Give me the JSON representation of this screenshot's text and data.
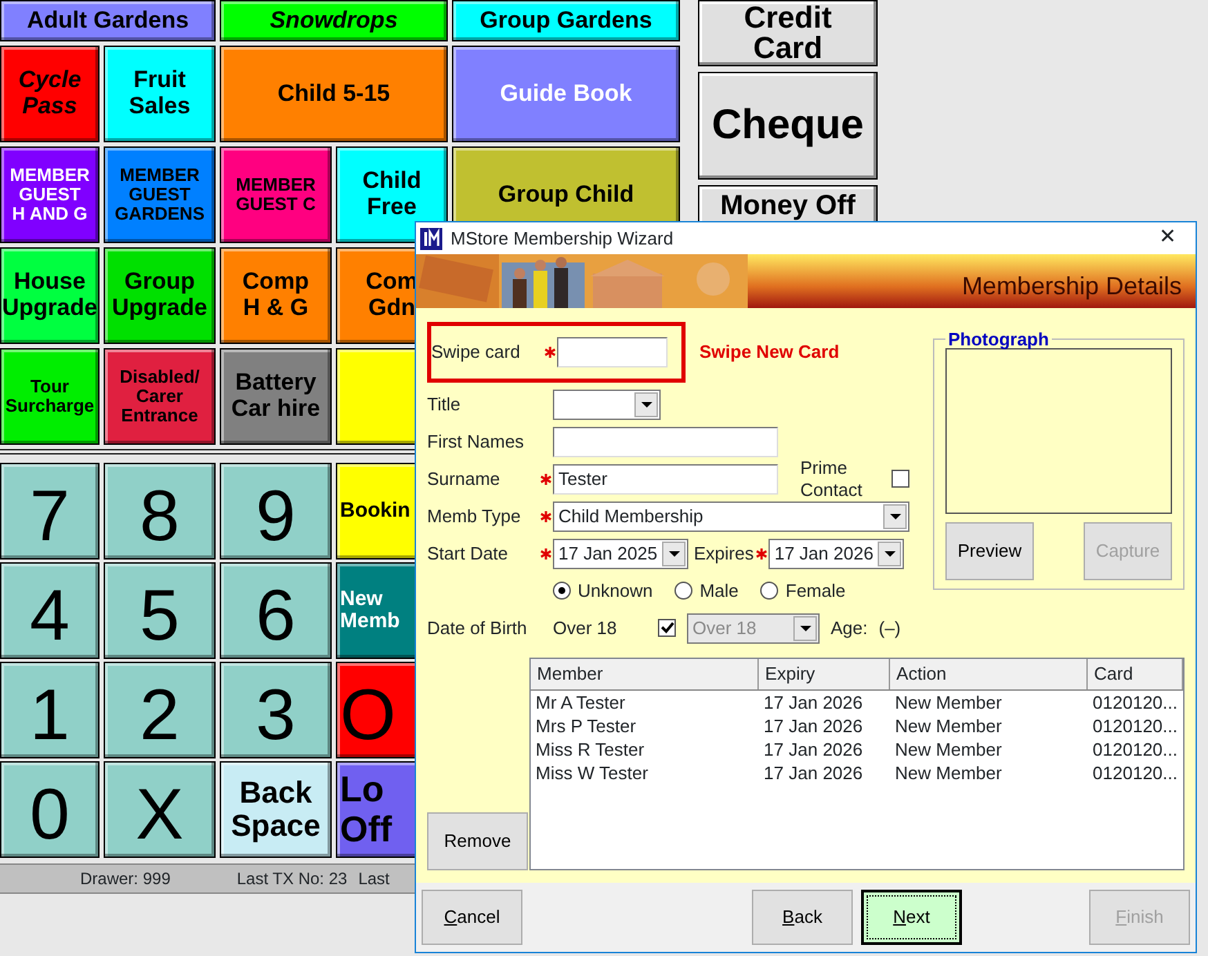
{
  "tile_rows": [
    [
      {
        "lines": [
          "Adult Gardens"
        ],
        "color": "#8080ff",
        "light_text": false,
        "kind": "title",
        "wide": true,
        "italic": false
      },
      {
        "lines": [
          "Snowdrops"
        ],
        "color": "#00ff00",
        "light_text": false,
        "kind": "title",
        "wide": true,
        "italic": true
      },
      {
        "lines": [
          "Group Gardens"
        ],
        "color": "#00ffff",
        "light_text": false,
        "kind": "title",
        "wide": true,
        "italic": false
      }
    ],
    [
      {
        "lines": [
          "Cycle",
          "Pass"
        ],
        "color": "#ff0000",
        "light_text": false,
        "kind": "title",
        "wide": false,
        "italic": true
      },
      {
        "lines": [
          "Fruit",
          "Sales"
        ],
        "color": "#00ffff",
        "light_text": false,
        "kind": "title",
        "wide": false,
        "italic": false
      },
      {
        "lines": [
          "Child 5-15"
        ],
        "color": "#ff8000",
        "light_text": false,
        "kind": "title",
        "wide": true,
        "italic": false
      },
      {
        "lines": [
          "Guide Book"
        ],
        "color": "#8080ff",
        "light_text": true,
        "kind": "title",
        "wide": true,
        "italic": false
      }
    ],
    [
      {
        "lines": [
          "MEMBER",
          "GUEST",
          "H AND G"
        ],
        "color": "#8000ff",
        "light_text": true,
        "kind": "caption",
        "wide": false,
        "italic": false
      },
      {
        "lines": [
          "MEMBER",
          "GUEST",
          "GARDENS"
        ],
        "color": "#0080ff",
        "light_text": false,
        "kind": "caption",
        "wide": false,
        "italic": false
      },
      {
        "lines": [
          "MEMBER",
          "GUEST C"
        ],
        "color": "#ff0080",
        "light_text": false,
        "kind": "caption",
        "wide": false,
        "italic": false
      },
      {
        "lines": [
          "Child",
          "Free"
        ],
        "color": "#00ffff",
        "light_text": false,
        "kind": "title",
        "wide": false,
        "italic": false
      },
      {
        "lines": [
          "Group Child"
        ],
        "color": "#c0c030",
        "light_text": false,
        "kind": "title",
        "wide": true,
        "italic": false
      }
    ],
    [
      {
        "lines": [
          "House",
          "Upgrade"
        ],
        "color": "#00ff40",
        "light_text": false,
        "kind": "title",
        "wide": false,
        "italic": false
      },
      {
        "lines": [
          "Group",
          "Upgrade"
        ],
        "color": "#00e000",
        "light_text": false,
        "kind": "title",
        "wide": false,
        "italic": false
      },
      {
        "lines": [
          "Comp",
          "H & G"
        ],
        "color": "#ff8000",
        "light_text": false,
        "kind": "title",
        "wide": false,
        "italic": false
      },
      {
        "lines": [
          "Com",
          "Gdn"
        ],
        "color": "#ff8000",
        "light_text": false,
        "kind": "title",
        "wide": false,
        "italic": false
      }
    ],
    [
      {
        "lines": [
          "Tour",
          "Surcharge"
        ],
        "color": "#00ee00",
        "light_text": false,
        "kind": "caption",
        "wide": false,
        "italic": false
      },
      {
        "lines": [
          "Disabled/",
          "Carer",
          "Entrance"
        ],
        "color": "#e02040",
        "light_text": false,
        "kind": "caption",
        "wide": false,
        "italic": false
      },
      {
        "lines": [
          "Battery",
          "Car hire"
        ],
        "color": "#808080",
        "light_text": false,
        "kind": "title",
        "wide": false,
        "italic": false
      },
      {
        "color": "#ffff00",
        "kind": "title",
        "wide": false
      }
    ]
  ],
  "keypad_rows": [
    [
      {
        "kind": "digit",
        "lines": [
          "7"
        ],
        "color": "#90d0c8",
        "light_text": false
      },
      {
        "kind": "digit",
        "lines": [
          "8"
        ],
        "color": "#90d0c8",
        "light_text": false
      },
      {
        "kind": "digit",
        "lines": [
          "9"
        ],
        "color": "#90d0c8",
        "light_text": false
      },
      {
        "kind": "word",
        "lines": [
          "Bookin"
        ],
        "color": "#ffff00",
        "light_text": false
      }
    ],
    [
      {
        "kind": "digit",
        "lines": [
          "4"
        ],
        "color": "#90d0c8",
        "light_text": false
      },
      {
        "kind": "digit",
        "lines": [
          "5"
        ],
        "color": "#90d0c8",
        "light_text": false
      },
      {
        "kind": "digit",
        "lines": [
          "6"
        ],
        "color": "#90d0c8",
        "light_text": false
      },
      {
        "kind": "word",
        "lines": [
          "New",
          "Memb"
        ],
        "color": "#008080",
        "light_text": true
      }
    ],
    [
      {
        "kind": "digit",
        "lines": [
          "1"
        ],
        "color": "#90d0c8",
        "light_text": false
      },
      {
        "kind": "digit",
        "lines": [
          "2"
        ],
        "color": "#90d0c8",
        "light_text": false
      },
      {
        "kind": "digit",
        "lines": [
          "3"
        ],
        "color": "#90d0c8",
        "light_text": false
      },
      {
        "kind": "digit",
        "lines": [
          "O"
        ],
        "color": "#ff0000",
        "light_text": false
      }
    ],
    [
      {
        "kind": "digit",
        "lines": [
          "0"
        ],
        "color": "#90d0c8",
        "light_text": false
      },
      {
        "kind": "digit",
        "lines": [
          "X"
        ],
        "color": "#90d0c8",
        "light_text": false
      },
      {
        "kind": "big",
        "lines": [
          "Back",
          "Space"
        ],
        "color": "#c8ecf4",
        "light_text": false
      },
      {
        "kind": "big",
        "lines": [
          "Lo",
          "Off"
        ],
        "color": "#7060f0",
        "light_text": false
      }
    ]
  ],
  "payment_buttons": [
    {
      "lines": [
        "Credit",
        "Card"
      ]
    },
    {
      "lines": [
        "Cheque"
      ]
    },
    {
      "lines": [
        "Money Off"
      ]
    }
  ],
  "status_bar": [
    "Drawer: 999",
    "Last TX No: 23",
    "Last"
  ],
  "dialog": {
    "title": "MStore Membership Wizard",
    "close": "✕",
    "header": "Membership Details",
    "fields": [
      {
        "kind": "text",
        "label": "Swipe card",
        "required": true,
        "highlighted": true,
        "note": "Swipe New Card"
      },
      {
        "kind": "select",
        "label": "Title",
        "required": false,
        "highlighted": false
      },
      {
        "kind": "text",
        "label": "First Names",
        "required": false,
        "highlighted": false
      },
      {
        "kind": "text",
        "label": "Surname",
        "required": true,
        "highlighted": false,
        "value": "Tester",
        "side_checkbox": {
          "label": "Prime Contact",
          "checked": false
        }
      },
      {
        "kind": "select",
        "label": "Memb Type",
        "required": true,
        "highlighted": false,
        "value": "Child Membership"
      },
      {
        "kind": "dates",
        "label": "Start Date",
        "required": true,
        "highlighted": false,
        "value": "17 Jan 2025",
        "expires": {
          "label": "Expires",
          "required": true,
          "value": "17 Jan 2026"
        }
      }
    ],
    "gender": [
      {
        "label": "Unknown",
        "selected": true
      },
      {
        "label": "Male",
        "selected": false
      },
      {
        "label": "Female",
        "selected": false
      }
    ],
    "dob": {
      "label": "Date of Birth",
      "value": "Over 18",
      "checked": true,
      "select_value": "Over 18",
      "select_disabled": true,
      "age_label": "Age:",
      "age_value": "(–)"
    },
    "photograph": {
      "title": "Photograph",
      "buttons": [
        {
          "label": "Preview",
          "disabled": false
        },
        {
          "label": "Capture",
          "disabled": true
        }
      ]
    },
    "remove": "Remove",
    "table": {
      "columns": [
        "Member",
        "Expiry",
        "Action",
        "Card"
      ],
      "rows": [
        [
          "Mr A Tester",
          "17 Jan 2026",
          "New Member",
          "0120120..."
        ],
        [
          "Mrs P Tester",
          "17 Jan 2026",
          "New Member",
          "0120120..."
        ],
        [
          "Miss R Tester",
          "17 Jan 2026",
          "New Member",
          "0120120..."
        ],
        [
          "Miss W Tester",
          "17 Jan 2026",
          "New Member",
          "0120120..."
        ]
      ]
    },
    "footer_buttons": [
      {
        "label": "Cancel",
        "disabled": false,
        "default": false,
        "access_key": true
      },
      {
        "label": "Back",
        "disabled": false,
        "default": false,
        "access_key": true
      },
      {
        "label": "Next",
        "disabled": false,
        "default": true,
        "access_key": true
      },
      {
        "label": "Finish",
        "disabled": true,
        "default": false,
        "access_key": true
      }
    ]
  }
}
